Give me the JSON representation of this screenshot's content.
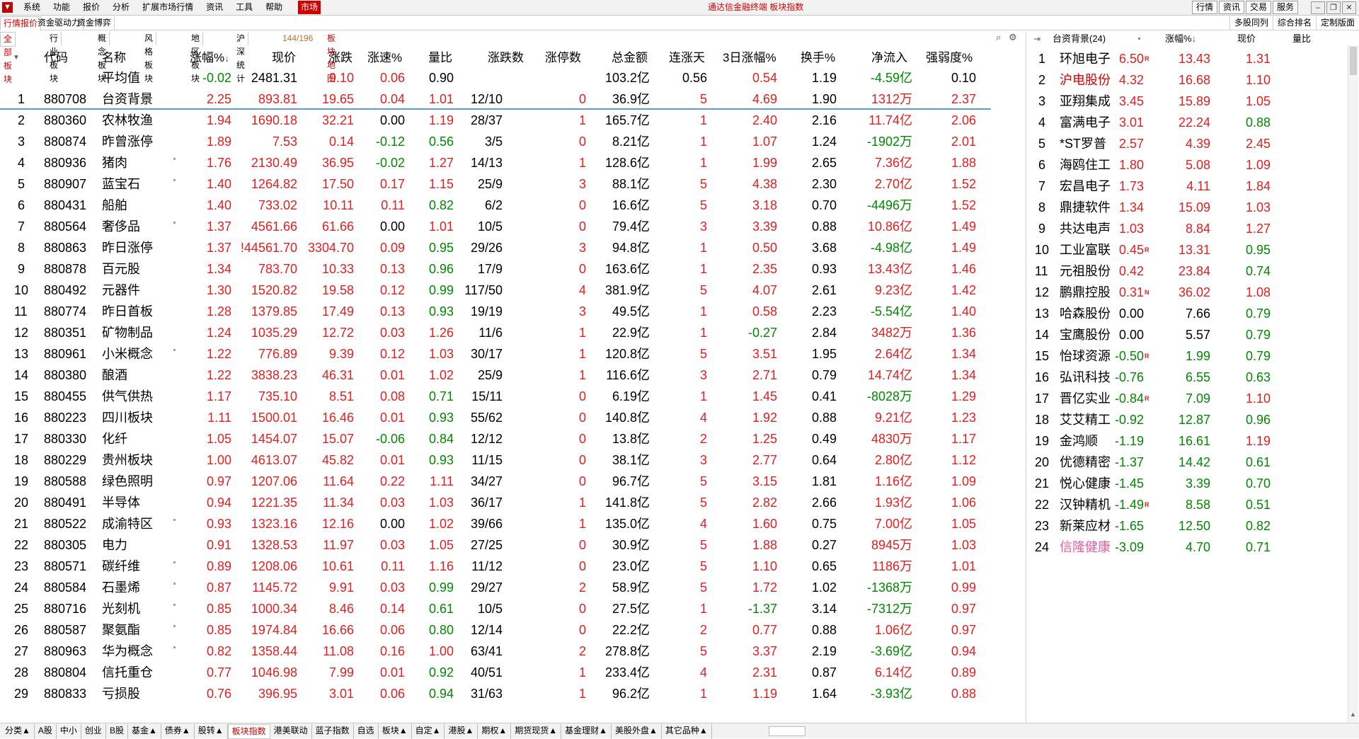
{
  "menubar": {
    "items": [
      "系统",
      "功能",
      "报价",
      "分析",
      "扩展市场行情",
      "资讯",
      "工具",
      "帮助"
    ],
    "market": "市场",
    "title": "通达信金融终端 板块指数",
    "right_buttons": [
      "行情",
      "资讯",
      "交易",
      "服务"
    ]
  },
  "tabs_top": [
    "行情报价",
    "资金驱动力",
    "资金博弈"
  ],
  "right_tabs": [
    "多股同列",
    "综合排名",
    "定制版面"
  ],
  "tabs_sub": [
    "全部板块",
    "行业板块",
    "概念板块",
    "风格板块",
    "地区板块",
    "沪深统计"
  ],
  "page_count": "144/196",
  "map_link": "板块地图",
  "columns": {
    "code": "代码",
    "name": "名称",
    "change_pct": "涨幅%",
    "price": "现价",
    "change": "涨跌",
    "speed": "涨速%",
    "vol_ratio": "量比",
    "up_down": "涨跌数",
    "limit_up": "涨停数",
    "amount": "总金额",
    "streak": "连涨天",
    "d3": "3日涨幅%",
    "turnover": "换手%",
    "net_flow": "净流入",
    "strength": "强弱度%"
  },
  "average": {
    "name": "平均值",
    "chg": "-0.02",
    "price": "2481.31",
    "change": "9.10",
    "speed": "0.06",
    "vr": "0.90",
    "amount": "103.2亿",
    "streak": "0.56",
    "d3": "0.54",
    "turnover": "1.19",
    "flow": "-4.59亿",
    "strength": "0.10"
  },
  "rows": [
    {
      "n": "1",
      "code": "880708",
      "name": "台资背景",
      "dot": false,
      "chg": "2.25",
      "price": "893.81",
      "change": "19.65",
      "speed": "0.04",
      "vr": "1.01",
      "ud": "12/10",
      "lu": "0",
      "amount": "36.9亿",
      "streak": "5",
      "d3": "4.69",
      "turnover": "1.90",
      "flow": "1312万",
      "strength": "2.37"
    },
    {
      "n": "2",
      "code": "880360",
      "name": "农林牧渔",
      "dot": false,
      "chg": "1.94",
      "price": "1690.18",
      "change": "32.21",
      "speed": "0.00",
      "vr": "1.19",
      "ud": "28/37",
      "lu": "1",
      "amount": "165.7亿",
      "streak": "1",
      "d3": "2.40",
      "turnover": "2.16",
      "flow": "11.74亿",
      "strength": "2.06"
    },
    {
      "n": "3",
      "code": "880874",
      "name": "昨曾涨停",
      "dot": false,
      "chg": "1.89",
      "price": "7.53",
      "change": "0.14",
      "speed": "-0.12",
      "vr": "0.56",
      "ud": "3/5",
      "lu": "0",
      "amount": "8.21亿",
      "streak": "1",
      "d3": "1.07",
      "turnover": "1.24",
      "flow": "-1902万",
      "strength": "2.01"
    },
    {
      "n": "4",
      "code": "880936",
      "name": "猪肉",
      "dot": true,
      "chg": "1.76",
      "price": "2130.49",
      "change": "36.95",
      "speed": "-0.02",
      "vr": "1.27",
      "ud": "14/13",
      "lu": "1",
      "amount": "128.6亿",
      "streak": "1",
      "d3": "1.99",
      "turnover": "2.65",
      "flow": "7.36亿",
      "strength": "1.88"
    },
    {
      "n": "5",
      "code": "880907",
      "name": "蓝宝石",
      "dot": true,
      "chg": "1.40",
      "price": "1264.82",
      "change": "17.50",
      "speed": "0.17",
      "vr": "1.15",
      "ud": "25/9",
      "lu": "3",
      "amount": "88.1亿",
      "streak": "5",
      "d3": "4.38",
      "turnover": "2.30",
      "flow": "2.70亿",
      "strength": "1.52"
    },
    {
      "n": "6",
      "code": "880431",
      "name": "船舶",
      "dot": false,
      "chg": "1.40",
      "price": "733.02",
      "change": "10.11",
      "speed": "0.11",
      "vr": "0.82",
      "ud": "6/2",
      "lu": "0",
      "amount": "16.6亿",
      "streak": "5",
      "d3": "3.18",
      "turnover": "0.70",
      "flow": "-4496万",
      "strength": "1.52"
    },
    {
      "n": "7",
      "code": "880564",
      "name": "奢侈品",
      "dot": true,
      "chg": "1.37",
      "price": "4561.66",
      "change": "61.66",
      "speed": "0.00",
      "vr": "1.01",
      "ud": "10/5",
      "lu": "0",
      "amount": "79.4亿",
      "streak": "3",
      "d3": "3.39",
      "turnover": "0.88",
      "flow": "10.86亿",
      "strength": "1.49"
    },
    {
      "n": "8",
      "code": "880863",
      "name": "昨日涨停",
      "dot": false,
      "chg": "1.37",
      "price": "!44561.70",
      "change": "3304.70",
      "speed": "0.09",
      "vr": "0.95",
      "ud": "29/26",
      "lu": "3",
      "amount": "94.8亿",
      "streak": "1",
      "d3": "0.50",
      "turnover": "3.68",
      "flow": "-4.98亿",
      "strength": "1.49"
    },
    {
      "n": "9",
      "code": "880878",
      "name": "百元股",
      "dot": false,
      "chg": "1.34",
      "price": "783.70",
      "change": "10.33",
      "speed": "0.13",
      "vr": "0.96",
      "ud": "17/9",
      "lu": "0",
      "amount": "163.6亿",
      "streak": "1",
      "d3": "2.35",
      "turnover": "0.93",
      "flow": "13.43亿",
      "strength": "1.46"
    },
    {
      "n": "10",
      "code": "880492",
      "name": "元器件",
      "dot": false,
      "chg": "1.30",
      "price": "1520.82",
      "change": "19.58",
      "speed": "0.12",
      "vr": "0.99",
      "ud": "117/50",
      "lu": "4",
      "amount": "381.9亿",
      "streak": "5",
      "d3": "4.07",
      "turnover": "2.61",
      "flow": "9.23亿",
      "strength": "1.42"
    },
    {
      "n": "11",
      "code": "880774",
      "name": "昨日首板",
      "dot": false,
      "chg": "1.28",
      "price": "1379.85",
      "change": "17.49",
      "speed": "0.13",
      "vr": "0.93",
      "ud": "19/19",
      "lu": "3",
      "amount": "49.5亿",
      "streak": "1",
      "d3": "0.58",
      "turnover": "2.23",
      "flow": "-5.54亿",
      "strength": "1.40"
    },
    {
      "n": "12",
      "code": "880351",
      "name": "矿物制品",
      "dot": false,
      "chg": "1.24",
      "price": "1035.29",
      "change": "12.72",
      "speed": "0.03",
      "vr": "1.26",
      "ud": "11/6",
      "lu": "1",
      "amount": "22.9亿",
      "streak": "1",
      "d3": "-0.27",
      "turnover": "2.84",
      "flow": "3482万",
      "strength": "1.36"
    },
    {
      "n": "13",
      "code": "880961",
      "name": "小米概念",
      "dot": true,
      "chg": "1.22",
      "price": "776.89",
      "change": "9.39",
      "speed": "0.12",
      "vr": "1.03",
      "ud": "30/17",
      "lu": "1",
      "amount": "120.8亿",
      "streak": "5",
      "d3": "3.51",
      "turnover": "1.95",
      "flow": "2.64亿",
      "strength": "1.34"
    },
    {
      "n": "14",
      "code": "880380",
      "name": "酿酒",
      "dot": false,
      "chg": "1.22",
      "price": "3838.23",
      "change": "46.31",
      "speed": "0.01",
      "vr": "1.02",
      "ud": "25/9",
      "lu": "1",
      "amount": "116.6亿",
      "streak": "3",
      "d3": "2.71",
      "turnover": "0.79",
      "flow": "14.74亿",
      "strength": "1.34"
    },
    {
      "n": "15",
      "code": "880455",
      "name": "供气供热",
      "dot": false,
      "chg": "1.17",
      "price": "735.10",
      "change": "8.51",
      "speed": "0.08",
      "vr": "0.71",
      "ud": "15/11",
      "lu": "0",
      "amount": "6.19亿",
      "streak": "1",
      "d3": "1.45",
      "turnover": "0.41",
      "flow": "-8028万",
      "strength": "1.29"
    },
    {
      "n": "16",
      "code": "880223",
      "name": "四川板块",
      "dot": false,
      "chg": "1.11",
      "price": "1500.01",
      "change": "16.46",
      "speed": "0.01",
      "vr": "0.93",
      "ud": "55/62",
      "lu": "0",
      "amount": "140.8亿",
      "streak": "4",
      "d3": "1.92",
      "turnover": "0.88",
      "flow": "9.21亿",
      "strength": "1.23"
    },
    {
      "n": "17",
      "code": "880330",
      "name": "化纤",
      "dot": false,
      "chg": "1.05",
      "price": "1454.07",
      "change": "15.07",
      "speed": "-0.06",
      "vr": "0.84",
      "ud": "12/12",
      "lu": "0",
      "amount": "13.8亿",
      "streak": "2",
      "d3": "1.25",
      "turnover": "0.49",
      "flow": "4830万",
      "strength": "1.17"
    },
    {
      "n": "18",
      "code": "880229",
      "name": "贵州板块",
      "dot": false,
      "chg": "1.00",
      "price": "4613.07",
      "change": "45.82",
      "speed": "0.01",
      "vr": "0.93",
      "ud": "11/15",
      "lu": "0",
      "amount": "38.1亿",
      "streak": "3",
      "d3": "2.77",
      "turnover": "0.64",
      "flow": "2.80亿",
      "strength": "1.12"
    },
    {
      "n": "19",
      "code": "880588",
      "name": "绿色照明",
      "dot": false,
      "chg": "0.97",
      "price": "1207.06",
      "change": "11.64",
      "speed": "0.22",
      "vr": "1.11",
      "ud": "34/27",
      "lu": "0",
      "amount": "96.7亿",
      "streak": "5",
      "d3": "3.15",
      "turnover": "1.81",
      "flow": "1.16亿",
      "strength": "1.09"
    },
    {
      "n": "20",
      "code": "880491",
      "name": "半导体",
      "dot": false,
      "chg": "0.94",
      "price": "1221.35",
      "change": "11.34",
      "speed": "0.03",
      "vr": "1.03",
      "ud": "36/17",
      "lu": "1",
      "amount": "141.8亿",
      "streak": "5",
      "d3": "2.82",
      "turnover": "2.66",
      "flow": "1.93亿",
      "strength": "1.06"
    },
    {
      "n": "21",
      "code": "880522",
      "name": "成渝特区",
      "dot": true,
      "chg": "0.93",
      "price": "1323.16",
      "change": "12.16",
      "speed": "0.00",
      "vr": "1.02",
      "ud": "39/66",
      "lu": "1",
      "amount": "135.0亿",
      "streak": "4",
      "d3": "1.60",
      "turnover": "0.75",
      "flow": "7.00亿",
      "strength": "1.05"
    },
    {
      "n": "22",
      "code": "880305",
      "name": "电力",
      "dot": false,
      "chg": "0.91",
      "price": "1328.53",
      "change": "11.97",
      "speed": "0.03",
      "vr": "1.05",
      "ud": "27/25",
      "lu": "0",
      "amount": "30.9亿",
      "streak": "5",
      "d3": "1.88",
      "turnover": "0.27",
      "flow": "8945万",
      "strength": "1.03"
    },
    {
      "n": "23",
      "code": "880571",
      "name": "碳纤维",
      "dot": true,
      "chg": "0.89",
      "price": "1208.06",
      "change": "10.61",
      "speed": "0.11",
      "vr": "1.16",
      "ud": "11/12",
      "lu": "0",
      "amount": "23.0亿",
      "streak": "5",
      "d3": "1.10",
      "turnover": "0.65",
      "flow": "1186万",
      "strength": "1.01"
    },
    {
      "n": "24",
      "code": "880584",
      "name": "石墨烯",
      "dot": true,
      "chg": "0.87",
      "price": "1145.72",
      "change": "9.91",
      "speed": "0.03",
      "vr": "0.99",
      "ud": "29/27",
      "lu": "2",
      "amount": "58.9亿",
      "streak": "5",
      "d3": "1.72",
      "turnover": "1.02",
      "flow": "-1368万",
      "strength": "0.99"
    },
    {
      "n": "25",
      "code": "880716",
      "name": "光刻机",
      "dot": true,
      "chg": "0.85",
      "price": "1000.34",
      "change": "8.46",
      "speed": "0.14",
      "vr": "0.61",
      "ud": "10/5",
      "lu": "0",
      "amount": "27.5亿",
      "streak": "1",
      "d3": "-1.37",
      "turnover": "3.14",
      "flow": "-7312万",
      "strength": "0.97"
    },
    {
      "n": "26",
      "code": "880587",
      "name": "聚氨酯",
      "dot": true,
      "chg": "0.85",
      "price": "1974.84",
      "change": "16.66",
      "speed": "0.06",
      "vr": "0.80",
      "ud": "12/14",
      "lu": "0",
      "amount": "22.2亿",
      "streak": "2",
      "d3": "0.77",
      "turnover": "0.88",
      "flow": "1.06亿",
      "strength": "0.97"
    },
    {
      "n": "27",
      "code": "880963",
      "name": "华为概念",
      "dot": true,
      "chg": "0.82",
      "price": "1358.44",
      "change": "11.08",
      "speed": "0.16",
      "vr": "1.00",
      "ud": "63/41",
      "lu": "2",
      "amount": "278.8亿",
      "streak": "5",
      "d3": "3.37",
      "turnover": "2.19",
      "flow": "-3.69亿",
      "strength": "0.94"
    },
    {
      "n": "28",
      "code": "880804",
      "name": "信托重仓",
      "dot": false,
      "chg": "0.77",
      "price": "1046.98",
      "change": "7.99",
      "speed": "0.01",
      "vr": "0.92",
      "ud": "40/51",
      "lu": "1",
      "amount": "233.4亿",
      "streak": "4",
      "d3": "2.31",
      "turnover": "0.87",
      "flow": "6.14亿",
      "strength": "0.89"
    },
    {
      "n": "29",
      "code": "880833",
      "name": "亏损股",
      "dot": false,
      "chg": "0.76",
      "price": "396.95",
      "change": "3.01",
      "speed": "0.06",
      "vr": "0.94",
      "ud": "31/63",
      "lu": "1",
      "amount": "96.2亿",
      "streak": "1",
      "d3": "1.19",
      "turnover": "1.64",
      "flow": "-3.93亿",
      "strength": "0.88"
    }
  ],
  "side": {
    "title": "台资背景(24)",
    "col_chg": "涨幅%",
    "col_price": "现价",
    "col_vr": "量比",
    "rows": [
      {
        "n": "1",
        "name": "环旭电子",
        "badge": "R",
        "chg": "6.50",
        "price": "13.43",
        "vr": "1.31",
        "nc": ""
      },
      {
        "n": "2",
        "name": "沪电股份",
        "badge": "",
        "chg": "4.32",
        "price": "16.68",
        "vr": "1.10",
        "nc": "red"
      },
      {
        "n": "3",
        "name": "亚翔集成",
        "badge": "",
        "chg": "3.45",
        "price": "15.89",
        "vr": "1.05",
        "nc": ""
      },
      {
        "n": "4",
        "name": "富满电子",
        "badge": "",
        "chg": "3.01",
        "price": "22.24",
        "vr": "0.88",
        "nc": ""
      },
      {
        "n": "5",
        "name": "*ST罗普",
        "badge": "",
        "chg": "2.57",
        "price": "4.39",
        "vr": "2.45",
        "nc": ""
      },
      {
        "n": "6",
        "name": "海鸥住工",
        "badge": "",
        "chg": "1.80",
        "price": "5.08",
        "vr": "1.09",
        "nc": ""
      },
      {
        "n": "7",
        "name": "宏昌电子",
        "badge": "",
        "chg": "1.73",
        "price": "4.11",
        "vr": "1.84",
        "nc": ""
      },
      {
        "n": "8",
        "name": "鼎捷软件",
        "badge": "",
        "chg": "1.34",
        "price": "15.09",
        "vr": "1.03",
        "nc": ""
      },
      {
        "n": "9",
        "name": "共达电声",
        "badge": "",
        "chg": "1.03",
        "price": "8.84",
        "vr": "1.27",
        "nc": ""
      },
      {
        "n": "10",
        "name": "工业富联",
        "badge": "R",
        "chg": "0.45",
        "price": "13.31",
        "vr": "0.95",
        "nc": ""
      },
      {
        "n": "11",
        "name": "元祖股份",
        "badge": "",
        "chg": "0.42",
        "price": "23.84",
        "vr": "0.74",
        "nc": ""
      },
      {
        "n": "12",
        "name": "鹏鼎控股",
        "badge": "N",
        "chg": "0.31",
        "price": "36.02",
        "vr": "1.08",
        "nc": ""
      },
      {
        "n": "13",
        "name": "哈森股份",
        "badge": "",
        "chg": "0.00",
        "price": "7.66",
        "vr": "0.79",
        "nc": ""
      },
      {
        "n": "14",
        "name": "宝鹰股份",
        "badge": "",
        "chg": "0.00",
        "price": "5.57",
        "vr": "0.79",
        "nc": ""
      },
      {
        "n": "15",
        "name": "怡球资源",
        "badge": "R",
        "chg": "-0.50",
        "price": "1.99",
        "vr": "0.79",
        "nc": ""
      },
      {
        "n": "16",
        "name": "弘讯科技",
        "badge": "",
        "chg": "-0.76",
        "price": "6.55",
        "vr": "0.63",
        "nc": ""
      },
      {
        "n": "17",
        "name": "晋亿实业",
        "badge": "R",
        "chg": "-0.84",
        "price": "7.09",
        "vr": "1.10",
        "nc": ""
      },
      {
        "n": "18",
        "name": "艾艾精工",
        "badge": "",
        "chg": "-0.92",
        "price": "12.87",
        "vr": "0.96",
        "nc": ""
      },
      {
        "n": "19",
        "name": "金鸿顺",
        "badge": "",
        "chg": "-1.19",
        "price": "16.61",
        "vr": "1.19",
        "nc": ""
      },
      {
        "n": "20",
        "name": "优德精密",
        "badge": "",
        "chg": "-1.37",
        "price": "14.42",
        "vr": "0.61",
        "nc": ""
      },
      {
        "n": "21",
        "name": "悦心健康",
        "badge": "",
        "chg": "-1.45",
        "price": "3.39",
        "vr": "0.70",
        "nc": ""
      },
      {
        "n": "22",
        "name": "汉钟精机",
        "badge": "R",
        "chg": "-1.49",
        "price": "8.58",
        "vr": "0.51",
        "nc": ""
      },
      {
        "n": "23",
        "name": "新莱应材",
        "badge": "",
        "chg": "-1.65",
        "price": "12.50",
        "vr": "0.82",
        "nc": ""
      },
      {
        "n": "24",
        "name": "信隆健康",
        "badge": "",
        "chg": "-3.09",
        "price": "4.70",
        "vr": "0.71",
        "nc": "pink"
      }
    ]
  },
  "bottom_tabs": [
    "分类▲",
    "A股",
    "中小",
    "创业",
    "B股",
    "基金▲",
    "债券▲",
    "股转▲",
    "板块指数",
    "港美联动",
    "蓝子指数",
    "自选",
    "板块▲",
    "自定▲",
    "港股▲",
    "期权▲",
    "期货现货▲",
    "基金理财▲",
    "美股外盘▲",
    "其它品种▲"
  ],
  "colors": {
    "up": "#e02020",
    "down": "#008800",
    "accent": "#d00000",
    "selection": "#5b9bd5"
  }
}
